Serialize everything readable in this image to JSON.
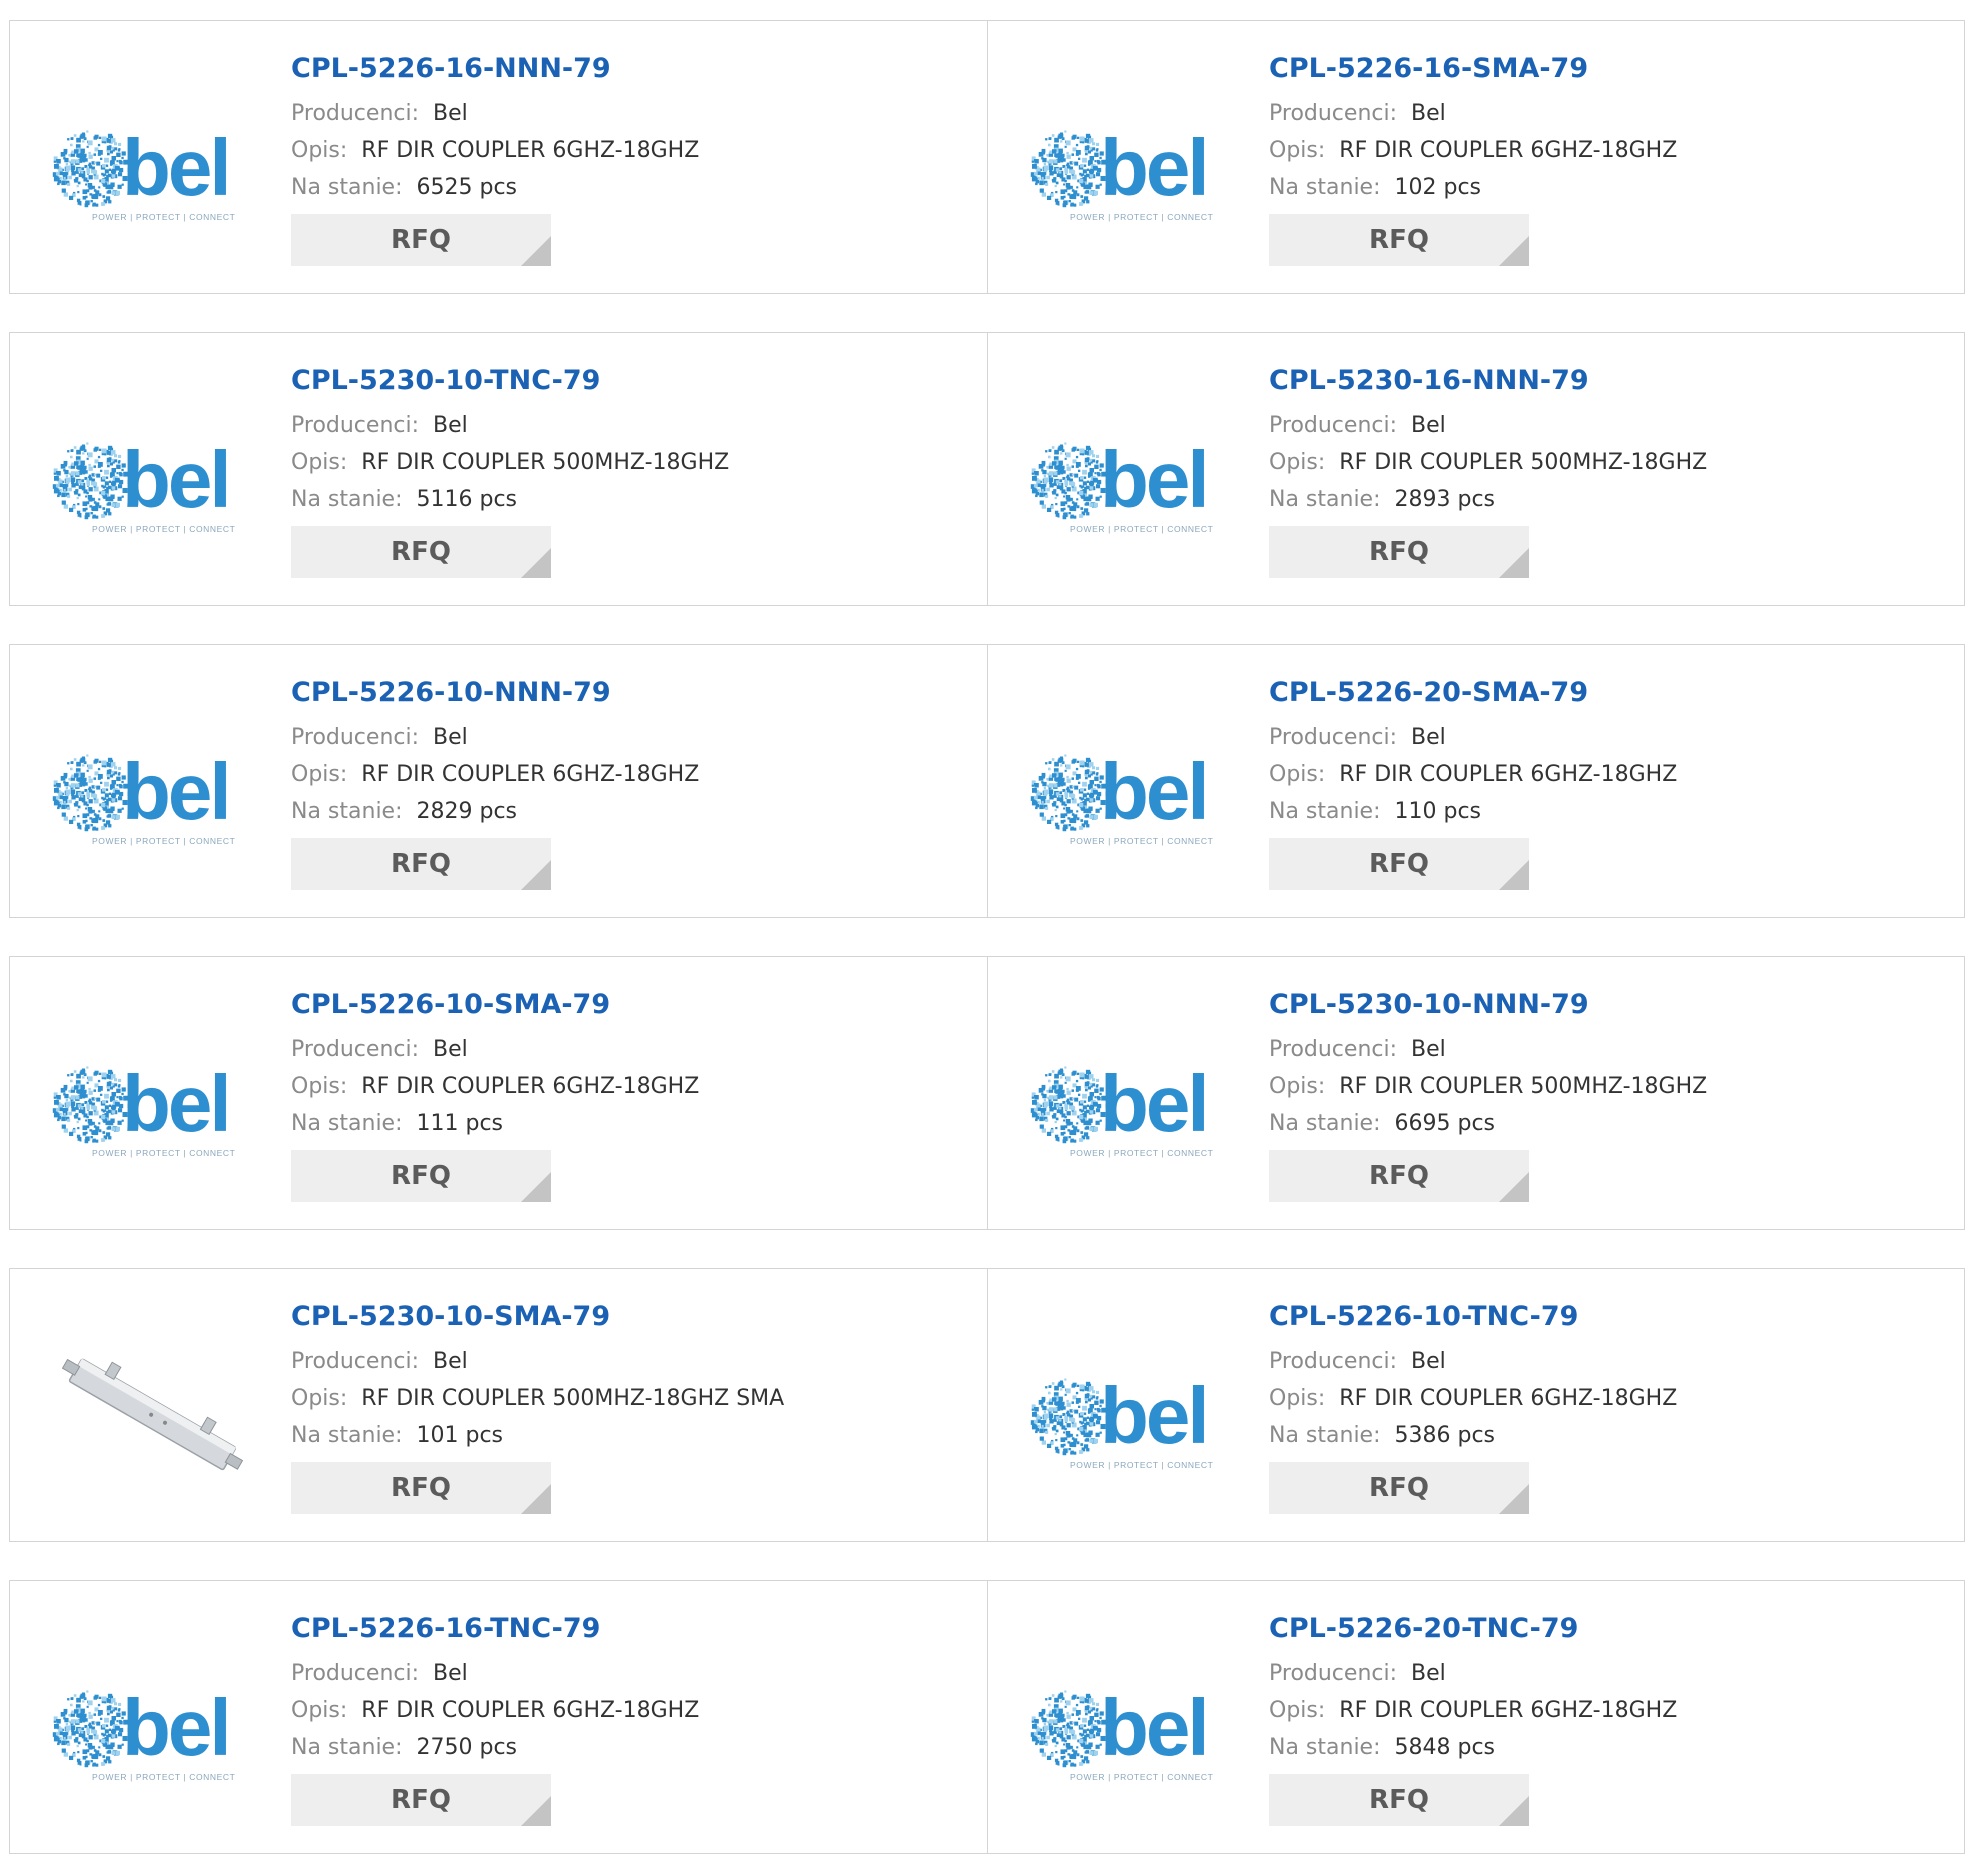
{
  "labels": {
    "manufacturer": "Producenci:",
    "description": "Opis:",
    "stock": "Na stanie:"
  },
  "rfq_label": "RFQ",
  "logo_lettering": "bel POWER | PROTECT | CONNECT",
  "colors": {
    "title": "#1b62b5",
    "logo_blue": "#2d8fd0",
    "rfq_bg": "#eeeeee",
    "border": "#d4d4d4"
  },
  "products": [
    {
      "part": "CPL-5226-16-NNN-79",
      "manufacturer": "Bel",
      "description": "RF DIR COUPLER 6GHZ-18GHZ",
      "stock": "6525 pcs",
      "image": "bel-logo"
    },
    {
      "part": "CPL-5226-16-SMA-79",
      "manufacturer": "Bel",
      "description": "RF DIR COUPLER 6GHZ-18GHZ",
      "stock": "102 pcs",
      "image": "bel-logo"
    },
    {
      "part": "CPL-5230-10-TNC-79",
      "manufacturer": "Bel",
      "description": "RF DIR COUPLER 500MHZ-18GHZ",
      "stock": "5116 pcs",
      "image": "bel-logo"
    },
    {
      "part": "CPL-5230-16-NNN-79",
      "manufacturer": "Bel",
      "description": "RF DIR COUPLER 500MHZ-18GHZ",
      "stock": "2893 pcs",
      "image": "bel-logo"
    },
    {
      "part": "CPL-5226-10-NNN-79",
      "manufacturer": "Bel",
      "description": "RF DIR COUPLER 6GHZ-18GHZ",
      "stock": "2829 pcs",
      "image": "bel-logo"
    },
    {
      "part": "CPL-5226-20-SMA-79",
      "manufacturer": "Bel",
      "description": "RF DIR COUPLER 6GHZ-18GHZ",
      "stock": "110 pcs",
      "image": "bel-logo"
    },
    {
      "part": "CPL-5226-10-SMA-79",
      "manufacturer": "Bel",
      "description": "RF DIR COUPLER 6GHZ-18GHZ",
      "stock": "111 pcs",
      "image": "bel-logo"
    },
    {
      "part": "CPL-5230-10-NNN-79",
      "manufacturer": "Bel",
      "description": "RF DIR COUPLER 500MHZ-18GHZ",
      "stock": "6695 pcs",
      "image": "bel-logo"
    },
    {
      "part": "CPL-5230-10-SMA-79",
      "manufacturer": "Bel",
      "description": "RF DIR COUPLER 500MHZ-18GHZ SMA",
      "stock": "101 pcs",
      "image": "coupler-photo"
    },
    {
      "part": "CPL-5226-10-TNC-79",
      "manufacturer": "Bel",
      "description": "RF DIR COUPLER 6GHZ-18GHZ",
      "stock": "5386 pcs",
      "image": "bel-logo"
    },
    {
      "part": "CPL-5226-16-TNC-79",
      "manufacturer": "Bel",
      "description": "RF DIR COUPLER 6GHZ-18GHZ",
      "stock": "2750 pcs",
      "image": "bel-logo"
    },
    {
      "part": "CPL-5226-20-TNC-79",
      "manufacturer": "Bel",
      "description": "RF DIR COUPLER 6GHZ-18GHZ",
      "stock": "5848 pcs",
      "image": "bel-logo"
    }
  ]
}
